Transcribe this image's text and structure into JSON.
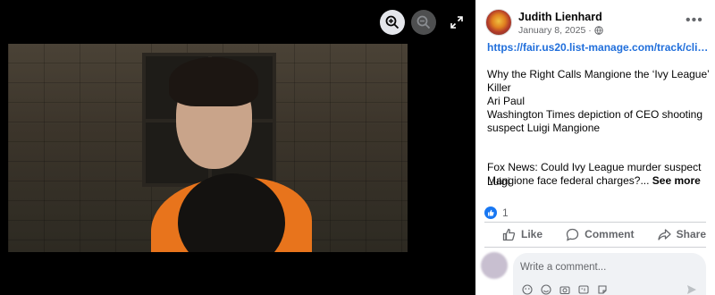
{
  "viewer": {
    "tools": [
      "zoom-in-icon",
      "zoom-out-icon",
      "fullscreen-icon"
    ]
  },
  "post": {
    "author": "Judith Lienhard",
    "date": "January 8, 2025 ·",
    "privacy_icon": "globe-icon",
    "link": "https://fair.us20.list-manage.com/track/click...",
    "lines": [
      "Why the Right Calls Mangione the ‘Ivy League’",
      "Killer",
      "Ari Paul",
      "Washington Times depiction of CEO shooting",
      "suspect Luigi Mangione"
    ],
    "second_para_1": "Fox News: Could Ivy League murder suspect Luigi",
    "second_para_2": "Mangione face federal charges?... ",
    "see_more": "See more",
    "reaction_count": "1",
    "actions": {
      "like": "Like",
      "comment": "Comment",
      "share": "Share"
    },
    "comment_placeholder": "Write a comment..."
  },
  "colors": {
    "link": "#216fdb",
    "like_badge": "#1877f2"
  }
}
